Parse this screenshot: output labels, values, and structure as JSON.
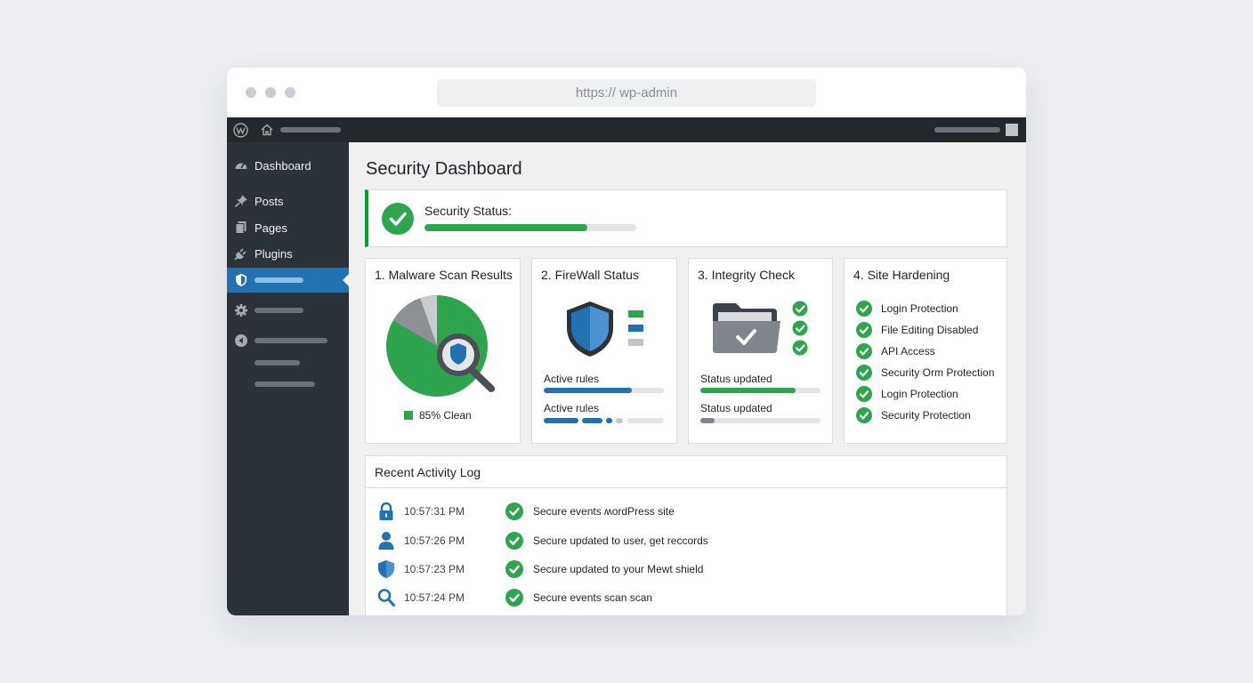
{
  "browser": {
    "url": "https://  wp-admin"
  },
  "sidebar": {
    "items": [
      {
        "label": "Dashboard",
        "icon": "dashboard-icon"
      },
      {
        "label": "Posts",
        "icon": "pin-icon"
      },
      {
        "label": "Pages",
        "icon": "pages-icon"
      },
      {
        "label": "Plugins",
        "icon": "plugin-icon"
      }
    ],
    "active_icon": "shield-icon"
  },
  "page": {
    "title": "Security Dashboard"
  },
  "security_status": {
    "title": "Security Status:",
    "progress": 0.77
  },
  "cards": {
    "malware": {
      "title": "1. Malware Scan Results",
      "legend": "85% Clean"
    },
    "firewall": {
      "title": "2. FireWall Status",
      "rows": [
        {
          "label": "Active rules",
          "progress": 0.73
        },
        {
          "label": "Active rules"
        }
      ]
    },
    "integrity": {
      "title": "3. Integrity Check",
      "rows": [
        {
          "label": "Status updated",
          "progress": 0.79
        },
        {
          "label": "Status updated",
          "progress": 0.12
        }
      ]
    },
    "hardening": {
      "title": "4. Site Hardening",
      "items": [
        "Login Protection",
        "File Editing Disabled",
        "API Access",
        "Security Orm Protection",
        "Login Protection",
        "Security Protection"
      ]
    }
  },
  "activity_log": {
    "title": "Recent Activity Log",
    "rows": [
      {
        "icon": "lock-icon",
        "time": "10:57:31 PM",
        "message": "Secure events ʍordPress site"
      },
      {
        "icon": "user-icon",
        "time": "10:57:26 PM",
        "message": "Secure updated to user, get reccords"
      },
      {
        "icon": "shield-icon",
        "time": "10:57:23 PM",
        "message": "Secure updated to your Mewt shield"
      },
      {
        "icon": "search-icon",
        "time": "10:57:24 PM",
        "message": "Secure events scan scan"
      }
    ]
  },
  "colors": {
    "accent": "#2271b1",
    "success": "#2ea44f",
    "sidebar": "#2c3338",
    "adminbar": "#23282d"
  }
}
